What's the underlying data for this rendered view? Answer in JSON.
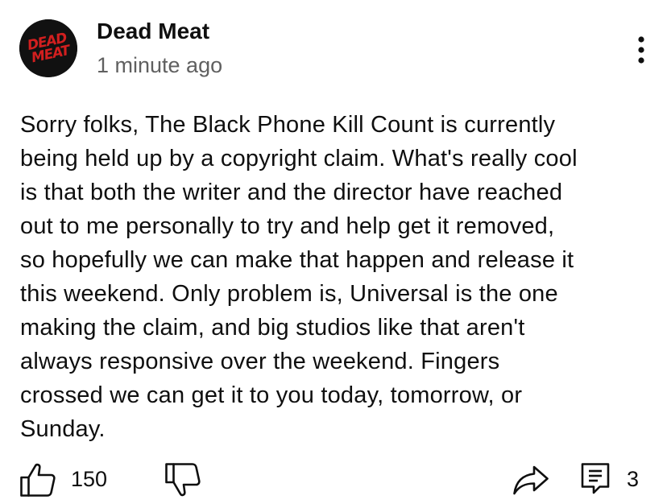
{
  "post": {
    "channel_name": "Dead Meat",
    "timestamp": "1 minute ago",
    "avatar": {
      "icon": "dead-meat-logo",
      "logo_text_top": "DEAD",
      "logo_text_bottom": "MEAT",
      "background": "#111111",
      "logo_color": "#d21f1f"
    },
    "menu_icon": "more-vertical-icon",
    "body_lines": [
      "Sorry folks, The Black Phone Kill Count is currently",
      "being held up by a copyright claim. What's really cool",
      "is that both the writer and the director have reached",
      "out to me personally to try and help get it removed,",
      "so hopefully we can make that happen and release it",
      "this weekend. Only problem is, Universal is the one",
      "making the claim, and big studios like that aren't",
      "always responsive over the weekend. Fingers",
      "crossed we can get it to you today, tomorrow, or",
      "Sunday."
    ]
  },
  "actions": {
    "like_icon": "thumbs-up-icon",
    "like_count": "150",
    "dislike_icon": "thumbs-down-icon",
    "share_icon": "share-icon",
    "comment_icon": "comment-icon",
    "comment_count": "3"
  }
}
